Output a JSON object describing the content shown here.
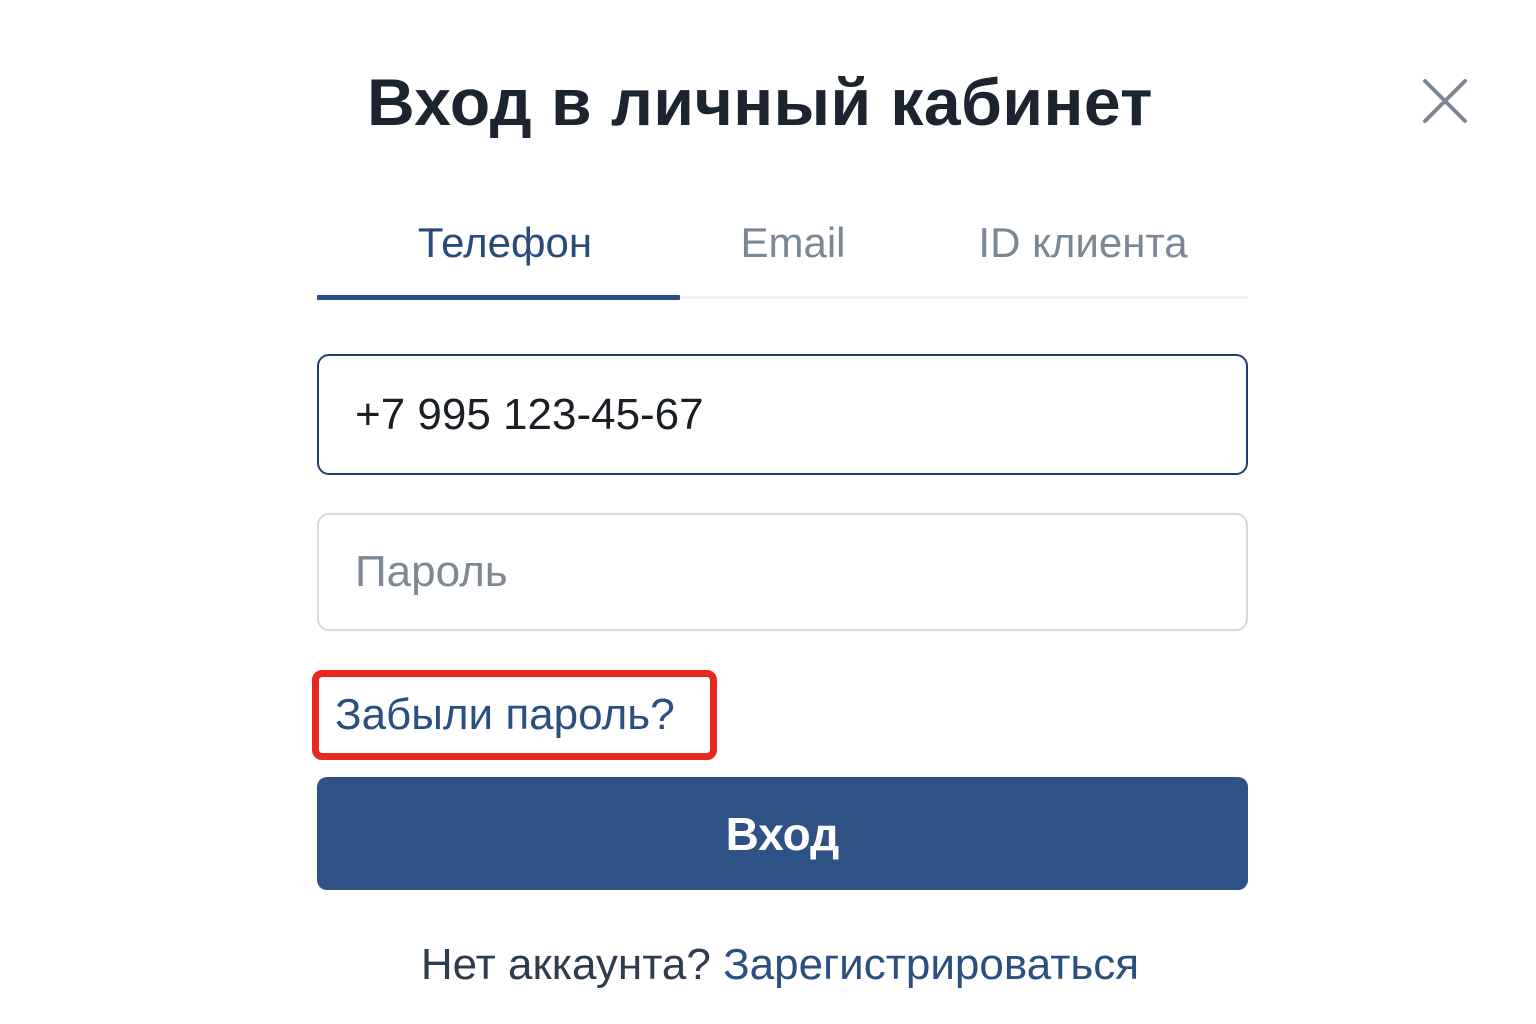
{
  "dialog": {
    "title": "Вход в личный кабинет",
    "close_icon": "close-icon"
  },
  "tabs": [
    {
      "label": "Телефон",
      "active": true
    },
    {
      "label": "Email",
      "active": false
    },
    {
      "label": "ID клиента",
      "active": false
    }
  ],
  "form": {
    "phone_value": "+7 995 123-45-67",
    "password_placeholder": "Пароль",
    "forgot_link": "Забыли пароль?",
    "submit_label": "Вход"
  },
  "footer": {
    "text": "Нет аккаунта?",
    "link": "Зарегистрироваться"
  },
  "colors": {
    "accent": "#2e5285",
    "active_tab": "#2a4a7a",
    "highlight": "#e8281f"
  }
}
